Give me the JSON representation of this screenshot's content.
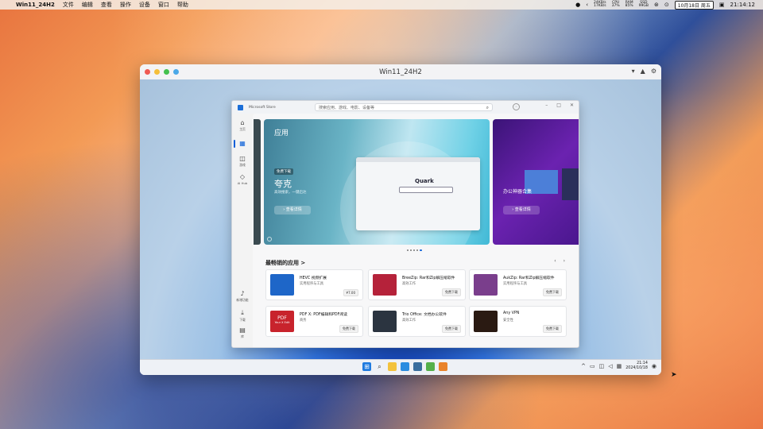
{
  "menubar": {
    "app_name": "Win11_24H2",
    "menus": [
      "文件",
      "编辑",
      "查看",
      "操作",
      "设备",
      "窗口",
      "帮助"
    ],
    "net_up": "24KB/s",
    "net_down": "17KB/s",
    "cpu_label": "CPU",
    "cpu_value": "37%",
    "ram_label": "RAM",
    "ram_value": "85%",
    "ssd_label": "SSD",
    "ssd_value": "99GB",
    "date": "10月18日 周五",
    "time": "21:14:12"
  },
  "vm_window": {
    "title": "Win11_24H2",
    "traffic_colors": [
      "#f05a52",
      "#f5bf3a",
      "#43c14e",
      "#4aa8e8"
    ]
  },
  "store": {
    "name": "Microsoft Store",
    "search_placeholder": "搜索应用、游戏、电影、设备等",
    "nav": {
      "home": "主页",
      "games": "游戏",
      "ai_hub": "AI Hub",
      "new": "新增功能",
      "downloads": "下载",
      "library": "库"
    },
    "hero": {
      "category": "应用",
      "badge": "免费下载",
      "app_name": "夸克",
      "subtitle": "高效搜索，一键启达",
      "button": "查看详情",
      "mock_logo": "Quark"
    },
    "hero2": {
      "name": "办公神器合集",
      "button": "查看详情"
    },
    "section_title": "最畅销的应用 >",
    "cards": [
      {
        "title": "HEVC 视频扩展",
        "category": "实用程序与工具",
        "price": "¥7.00",
        "icon_color": "#1e66c8"
      },
      {
        "title": "BreeZip: Rar和Zip解压缩软件",
        "category": "高效工作",
        "price": "免费下载",
        "icon_color": "#b5223a"
      },
      {
        "title": "AukZip: Rar和Zip解压缩软件",
        "category": "实用程序与工具",
        "price": "免费下载",
        "icon_color": "#7a3e8c"
      },
      {
        "title": "PDF X: PDF编辑和PDF阅读",
        "category": "商务",
        "price": "免费下载",
        "icon_color": "#c8232c"
      },
      {
        "title": "Trio Office: 文档办公软件",
        "category": "高效工作",
        "price": "免费下载",
        "icon_color": "#2b3440"
      },
      {
        "title": "Any VPN",
        "category": "安全性",
        "price": "免费下载",
        "icon_color": "#2a1a12"
      }
    ],
    "pdf_icon_text": "PDF",
    "pdf_icon_sub": "Your X Edit"
  },
  "taskbar": {
    "time": "21:14",
    "date": "2024/10/18"
  }
}
